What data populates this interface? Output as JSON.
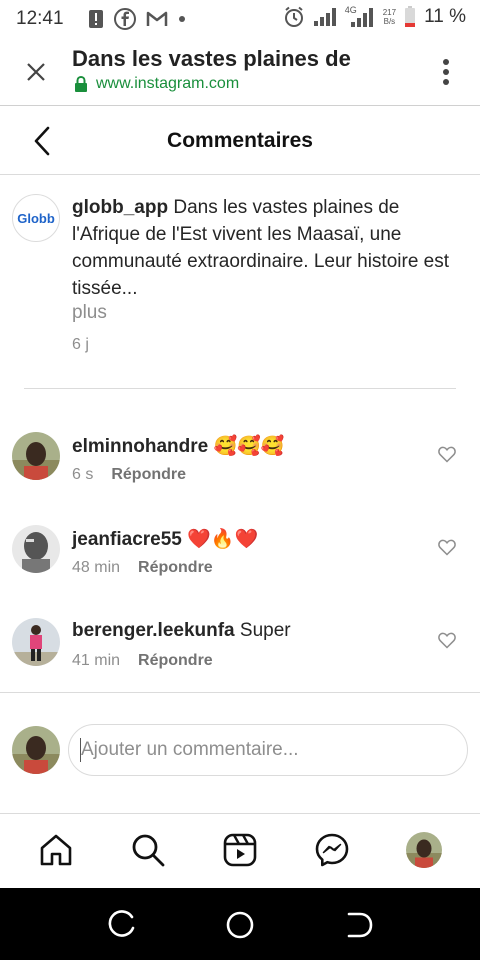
{
  "status_bar": {
    "time": "12:41",
    "battery": "11 %",
    "net_type": "4G",
    "speed_value": "217",
    "speed_unit": "B/s",
    "icons": [
      "alert-icon",
      "facebook-icon",
      "gmail-icon",
      "dot-icon",
      "alarm-icon",
      "signal-icon",
      "signal-4g-icon",
      "battery-icon"
    ]
  },
  "browser": {
    "title": "Dans les vastes plaines de",
    "url": "www.instagram.com",
    "close_icon": "close-icon",
    "menu_icon": "more-vertical-icon",
    "lock_icon": "lock-icon"
  },
  "header": {
    "title": "Commentaires",
    "back_icon": "back-chevron-icon"
  },
  "caption": {
    "avatar_text": "Globb",
    "username": "globb_app",
    "text": "Dans les vastes plaines de l'Afrique de l'Est vivent les Maasaï, une communauté extraordinaire. Leur histoire est tissée...",
    "more": "plus",
    "time": "6 j"
  },
  "comments": [
    {
      "username": "elminnohandre",
      "text": "🥰🥰🥰",
      "time": "6 s",
      "reply": "Répondre"
    },
    {
      "username": "jeanfiacre55",
      "text": "❤️🔥❤️",
      "time": "48 min",
      "reply": "Répondre"
    },
    {
      "username": "berenger.leekunfa",
      "text": "Super",
      "time": "41 min",
      "reply": "Répondre"
    }
  ],
  "add_comment": {
    "placeholder": "Ajouter un commentaire..."
  },
  "bottom_nav": [
    "home-icon",
    "search-icon",
    "reels-icon",
    "messenger-icon",
    "profile-avatar"
  ],
  "android_nav": [
    "recents-icon",
    "home-circle-icon",
    "back-icon"
  ],
  "colors": {
    "link_green": "#1a8f3c",
    "secondary_text": "#8e8e8e",
    "divider": "#dbdbdb"
  }
}
